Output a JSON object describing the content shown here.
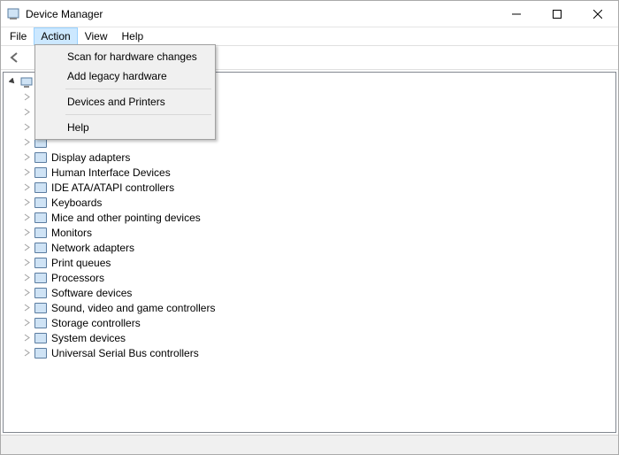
{
  "window": {
    "title": "Device Manager"
  },
  "menubar": {
    "file": "File",
    "action": "Action",
    "view": "View",
    "help": "Help"
  },
  "action_menu": {
    "scan": "Scan for hardware changes",
    "add_legacy": "Add legacy hardware",
    "devices_printers": "Devices and Printers",
    "help": "Help"
  },
  "tree": {
    "root": "",
    "items": [
      "",
      "",
      "",
      "",
      "Display adapters",
      "Human Interface Devices",
      "IDE ATA/ATAPI controllers",
      "Keyboards",
      "Mice and other pointing devices",
      "Monitors",
      "Network adapters",
      "Print queues",
      "Processors",
      "Software devices",
      "Sound, video and game controllers",
      "Storage controllers",
      "System devices",
      "Universal Serial Bus controllers"
    ]
  }
}
